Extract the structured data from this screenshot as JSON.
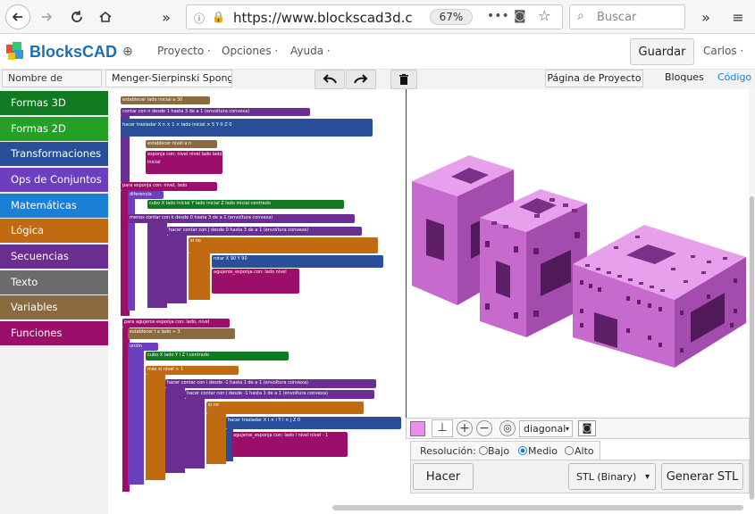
{
  "browser": {
    "url": "https://www.blockscad3d.c",
    "zoom": "67%",
    "search_placeholder": "Buscar"
  },
  "header": {
    "logo_text": "BlocksCAD",
    "menus": [
      "Proyecto ·",
      "Opciones ·",
      "Ayuda ·"
    ],
    "save_label": "Guardar",
    "user": "Carlos ·"
  },
  "toolbar": {
    "project_label": "Nombre de Proyecto",
    "project_name": "Menger-Sierpinski Sponge S",
    "project_page": "Página de Proyecto",
    "tab_blocks": "Bloques",
    "tab_code": "Código"
  },
  "sidebar": {
    "categories": [
      {
        "label": "Formas 3D",
        "color": "#0f7a1f"
      },
      {
        "label": "Formas 2D",
        "color": "#24a024"
      },
      {
        "label": "Transformaciones",
        "color": "#2a4f9a"
      },
      {
        "label": "Ops de Conjuntos",
        "color": "#6b3fc0"
      },
      {
        "label": "Matemáticas",
        "color": "#1c7fd6"
      },
      {
        "label": "Lógica",
        "color": "#c06a12"
      },
      {
        "label": "Secuencias",
        "color": "#6a2d91"
      },
      {
        "label": "Texto",
        "color": "#6b6b6b"
      },
      {
        "label": "Variables",
        "color": "#8a6a3f"
      },
      {
        "label": "Funciones",
        "color": "#9b0f6b"
      }
    ]
  },
  "viewer": {
    "color_swatch": "#e98ff0",
    "view_option": "diagonal",
    "resolution_label": "Resolución:",
    "res_low": "Bajo",
    "res_mid": "Medio",
    "res_high": "Alto",
    "make_label": "Hacer",
    "format": "STL (Binary)",
    "generate_label": "Generar STL"
  },
  "workspace": {
    "blocks": [
      "establecer lado inicial a 30",
      "contar con n desde 1 hasta 3 de a 1 (envoltura convexa)",
      "hacer trasladar X n × 1 × lado inicial × 5  Y 0 Z 0",
      "establecer nivel a n",
      "esponja con: nivel nivel lado lado inicial",
      "para esponja con: nivel, lado",
      "diferencia",
      "cubo X lado inicial Y lado inicial Z lado inicial centrado",
      "menos contar con k desde 0 hasta 3 de a 1 (envoltura convexa)",
      "hacer contar con j desde 0 hasta 3 de a 1 (envoltura convexa)",
      "si no",
      "rotar X 90 Y 90",
      "agujeros_esponja con: lado nivel",
      "para agujeros esponja con: lado, nivel",
      "establecer l a lado ÷ 3",
      "unión",
      "cubo X lado Y l Z l centrado",
      "más si nivel > 1",
      "hacer contar con i desde -1 hasta 1 de a 1 (envoltura convexa)",
      "hacer contar con j desde -1 hasta 1 de a 1 (envoltura convexa)",
      "si no",
      "hacer trasladar X l × i Y l × j Z 0",
      "agujeros_esponja con: lado l nivel nivel - 1"
    ]
  }
}
